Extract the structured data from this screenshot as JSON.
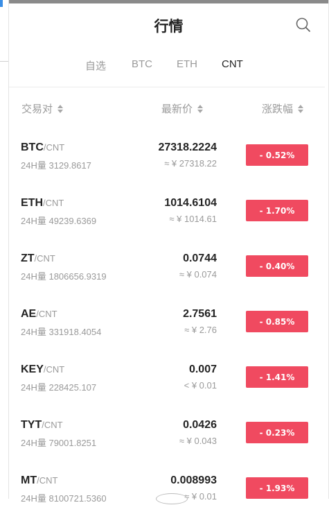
{
  "header": {
    "title": "行情"
  },
  "tabs": [
    {
      "label": "自选",
      "active": false
    },
    {
      "label": "BTC",
      "active": false
    },
    {
      "label": "ETH",
      "active": false
    },
    {
      "label": "CNT",
      "active": true
    }
  ],
  "columns": {
    "pair": "交易对",
    "price": "最新价",
    "change": "涨跌幅"
  },
  "markets": [
    {
      "base": "BTC",
      "quote": "/CNT",
      "volume": "24H量 3129.8617",
      "price": "27318.2224",
      "price_cny": "≈ ¥ 27318.22",
      "change": "- 0.52%"
    },
    {
      "base": "ETH",
      "quote": "/CNT",
      "volume": "24H量 49239.6369",
      "price": "1014.6104",
      "price_cny": "≈ ¥ 1014.61",
      "change": "- 1.70%"
    },
    {
      "base": "ZT",
      "quote": "/CNT",
      "volume": "24H量 1806656.9319",
      "price": "0.0744",
      "price_cny": "≈ ¥ 0.074",
      "change": "- 0.40%"
    },
    {
      "base": "AE",
      "quote": "/CNT",
      "volume": "24H量 331918.4054",
      "price": "2.7561",
      "price_cny": "≈ ¥ 2.76",
      "change": "- 0.85%"
    },
    {
      "base": "KEY",
      "quote": "/CNT",
      "volume": "24H量 228425.107",
      "price": "0.007",
      "price_cny": "< ¥ 0.01",
      "change": "- 1.41%"
    },
    {
      "base": "TYT",
      "quote": "/CNT",
      "volume": "24H量 79001.8251",
      "price": "0.0426",
      "price_cny": "≈ ¥ 0.043",
      "change": "- 0.23%"
    },
    {
      "base": "MT",
      "quote": "/CNT",
      "volume": "24H量 8100721.5360",
      "price": "0.008993",
      "price_cny": "≈ ¥ 0.01",
      "change": "- 1.93%"
    }
  ],
  "colors": {
    "down": "#f04a60",
    "muted": "#9a9a9a",
    "text": "#222222"
  },
  "icons": {
    "search": "search-icon",
    "sort": "sort-icon"
  }
}
